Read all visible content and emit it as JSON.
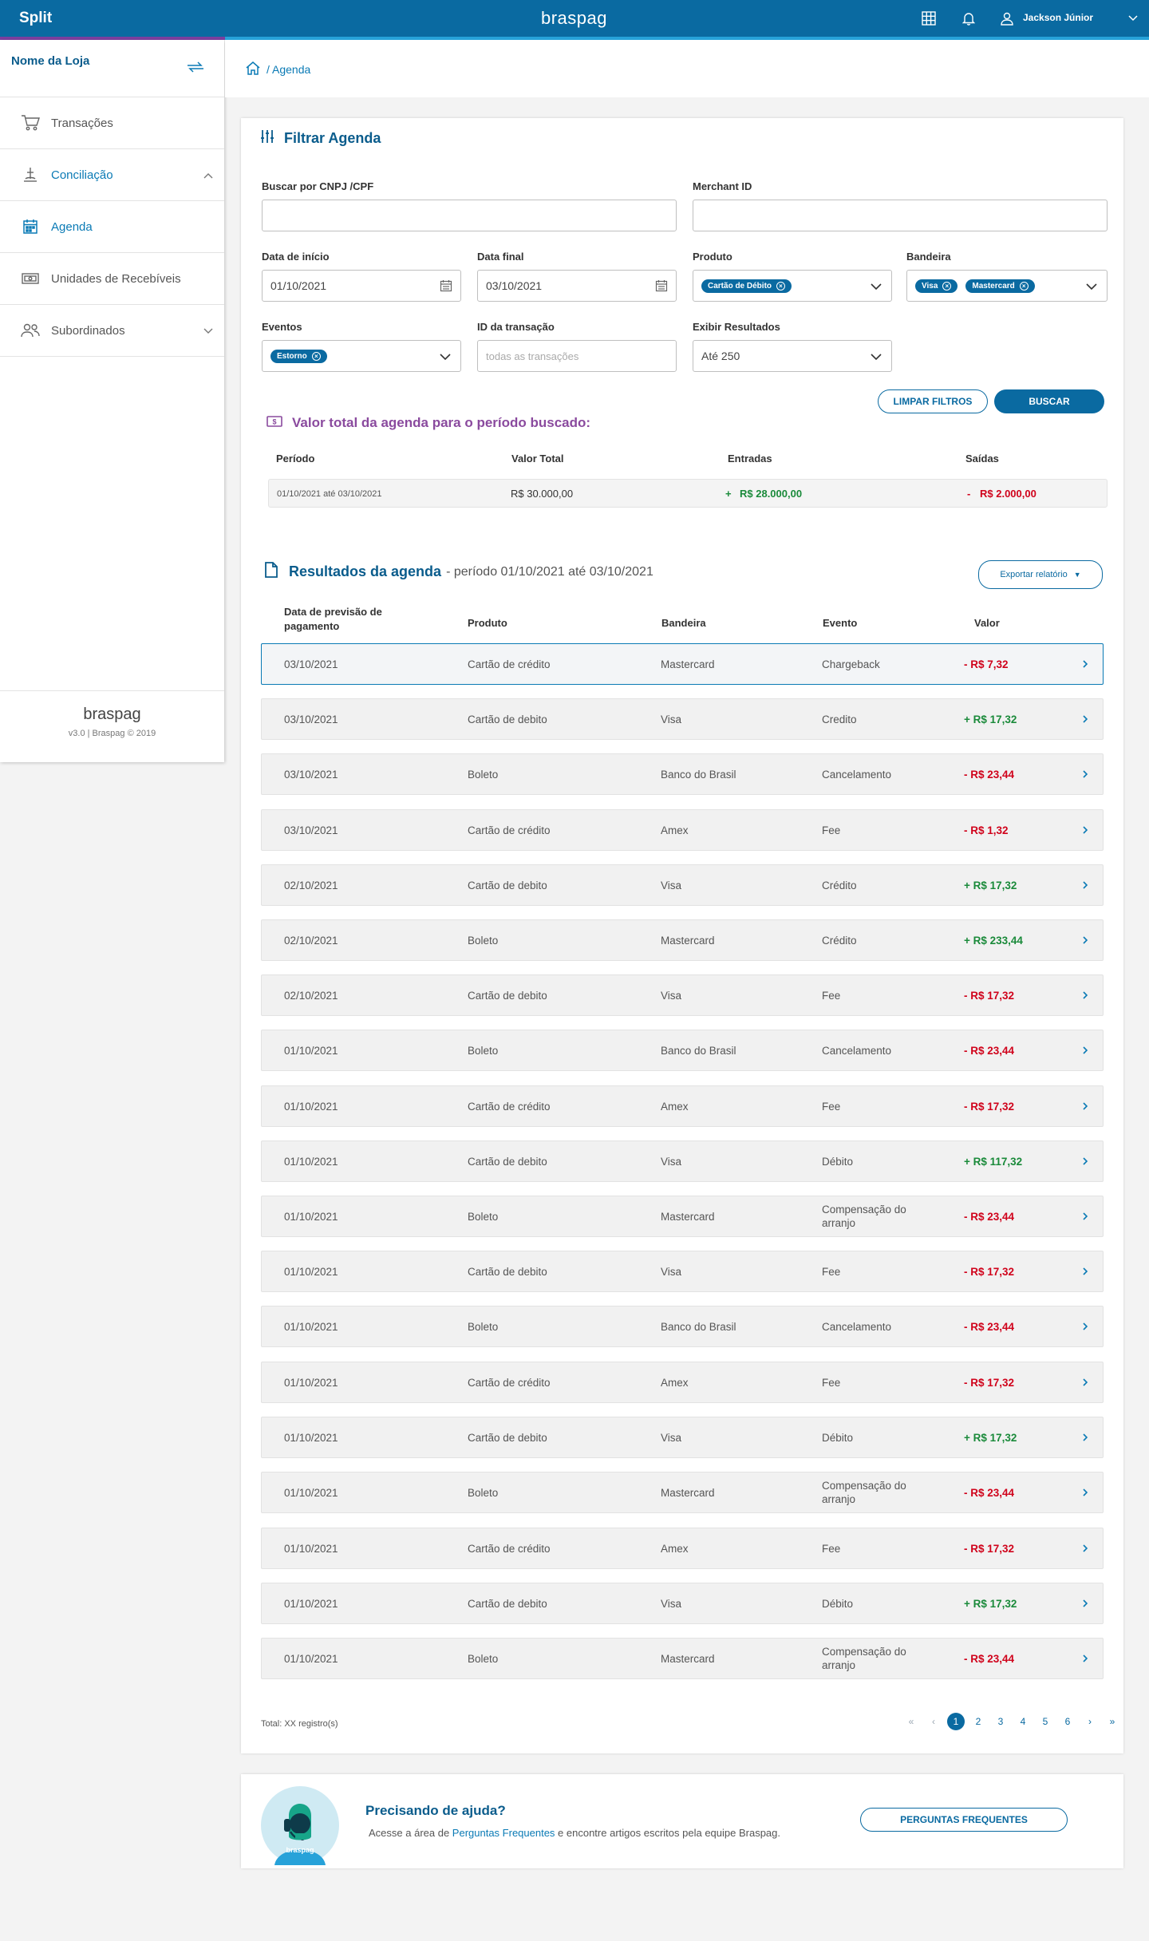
{
  "topbar": {
    "app_title": "Split",
    "brand": "braspag",
    "user_name": "Jackson Júnior"
  },
  "sidebar": {
    "store_name": "Nome da Loja",
    "items": [
      {
        "label": "Transações",
        "icon": "cart-icon"
      },
      {
        "label": "Conciliação",
        "icon": "scale-icon"
      },
      {
        "label": "Agenda",
        "icon": "calendar-icon"
      },
      {
        "label": "Unidades de Recebíveis",
        "icon": "money-icon"
      },
      {
        "label": "Subordinados",
        "icon": "users-icon"
      }
    ],
    "footer_logo": "braspag",
    "version": "v3.0 | Braspag © 2019"
  },
  "breadcrumb": {
    "current": "/ Agenda"
  },
  "filter": {
    "title": "Filtrar Agenda",
    "cnpj_label": "Buscar por CNPJ /CPF",
    "cnpj_value": "",
    "merchant_label": "Merchant ID",
    "merchant_value": "",
    "start_label": "Data de início",
    "start_value": "01/10/2021",
    "end_label": "Data final",
    "end_value": "03/10/2021",
    "produto_label": "Produto",
    "produto_chips": [
      "Cartão de Débito"
    ],
    "bandeira_label": "Bandeira",
    "bandeira_chips": [
      "Visa",
      "Mastercard"
    ],
    "eventos_label": "Eventos",
    "eventos_chips": [
      "Estorno"
    ],
    "transacao_label": "ID da transação",
    "transacao_placeholder": "todas as transações",
    "exibir_label": "Exibir Resultados",
    "exibir_value": "Até 250",
    "clear_button": "LIMPAR FILTROS",
    "search_button": "BUSCAR"
  },
  "totals": {
    "title": "Valor total da agenda para o período buscado:",
    "headers": {
      "periodo": "Período",
      "valor_total": "Valor Total",
      "entradas": "Entradas",
      "saidas": "Saídas"
    },
    "periodo": "01/10/2021 até 03/10/2021",
    "valor_total": "R$ 30.000,00",
    "entradas_sign": "+",
    "entradas": "R$ 28.000,00",
    "saidas_sign": "-",
    "saidas": "R$ 2.000,00"
  },
  "results": {
    "title": "Resultados da agenda",
    "period": "- período 01/10/2021 até 03/10/2021",
    "export_button": "Exportar relatório",
    "headers": {
      "data": "Data de previsão de pagamento",
      "produto": "Produto",
      "bandeira": "Bandeira",
      "evento": "Evento",
      "valor": "Valor"
    },
    "rows": [
      {
        "data": "03/10/2021",
        "produto": "Cartão de crédito",
        "bandeira": "Mastercard",
        "evento": "Chargeback",
        "valor": "-  R$ 7,32",
        "type": "neg"
      },
      {
        "data": "03/10/2021",
        "produto": "Cartão de debito",
        "bandeira": "Visa",
        "evento": "Credito",
        "valor": "+ R$ 17,32",
        "type": "pos"
      },
      {
        "data": "03/10/2021",
        "produto": "Boleto",
        "bandeira": "Banco do Brasil",
        "evento": "Cancelamento",
        "valor": "-  R$ 23,44",
        "type": "neg"
      },
      {
        "data": "03/10/2021",
        "produto": "Cartão de crédito",
        "bandeira": "Amex",
        "evento": "Fee",
        "valor": "-  R$ 1,32",
        "type": "neg"
      },
      {
        "data": "02/10/2021",
        "produto": "Cartão de debito",
        "bandeira": "Visa",
        "evento": "Crédito",
        "valor": "+  R$ 17,32",
        "type": "pos"
      },
      {
        "data": "02/10/2021",
        "produto": "Boleto",
        "bandeira": "Mastercard",
        "evento": "Crédito",
        "valor": "+  R$ 233,44",
        "type": "pos"
      },
      {
        "data": "02/10/2021",
        "produto": "Cartão de debito",
        "bandeira": "Visa",
        "evento": "Fee",
        "valor": "- R$ 17,32",
        "type": "neg"
      },
      {
        "data": "01/10/2021",
        "produto": "Boleto",
        "bandeira": "Banco do Brasil",
        "evento": "Cancelamento",
        "valor": "- R$ 23,44",
        "type": "neg"
      },
      {
        "data": "01/10/2021",
        "produto": "Cartão de crédito",
        "bandeira": "Amex",
        "evento": "Fee",
        "valor": "- R$ 17,32",
        "type": "neg"
      },
      {
        "data": "01/10/2021",
        "produto": "Cartão de debito",
        "bandeira": "Visa",
        "evento": "Débito",
        "valor": "+ R$ 117,32",
        "type": "pos"
      },
      {
        "data": "01/10/2021",
        "produto": "Boleto",
        "bandeira": "Mastercard",
        "evento": "Compensação do arranjo",
        "valor": "- R$ 23,44",
        "type": "neg"
      },
      {
        "data": "01/10/2021",
        "produto": "Cartão de debito",
        "bandeira": "Visa",
        "evento": "Fee",
        "valor": "- R$ 17,32",
        "type": "neg"
      },
      {
        "data": "01/10/2021",
        "produto": "Boleto",
        "bandeira": "Banco do Brasil",
        "evento": "Cancelamento",
        "valor": "- R$ 23,44",
        "type": "neg"
      },
      {
        "data": "01/10/2021",
        "produto": "Cartão de crédito",
        "bandeira": "Amex",
        "evento": "Fee",
        "valor": "- R$ 17,32",
        "type": "neg"
      },
      {
        "data": "01/10/2021",
        "produto": "Cartão de debito",
        "bandeira": "Visa",
        "evento": "Débito",
        "valor": "+ R$ 17,32",
        "type": "pos"
      },
      {
        "data": "01/10/2021",
        "produto": "Boleto",
        "bandeira": "Mastercard",
        "evento": "Compensação do arranjo",
        "valor": "- R$ 23,44",
        "type": "neg"
      },
      {
        "data": "01/10/2021",
        "produto": "Cartão de crédito",
        "bandeira": "Amex",
        "evento": "Fee",
        "valor": "- R$ 17,32",
        "type": "neg"
      },
      {
        "data": "01/10/2021",
        "produto": "Cartão de debito",
        "bandeira": "Visa",
        "evento": "Débito",
        "valor": "+ R$ 17,32",
        "type": "pos"
      },
      {
        "data": "01/10/2021",
        "produto": "Boleto",
        "bandeira": "Mastercard",
        "evento": "Compensação do arranjo",
        "valor": "- R$ 23,44",
        "type": "neg"
      }
    ],
    "total_records": "Total: XX registro(s)",
    "pages": [
      "1",
      "2",
      "3",
      "4",
      "5",
      "6"
    ],
    "current_page": "1"
  },
  "help": {
    "title": "Precisando de ajuda?",
    "desc_before": "Acesse a área de ",
    "desc_link": "Perguntas Frequentes",
    "desc_after": " e encontre artigos escritos pela equipe Braspag.",
    "button": "PERGUNTAS FREQUENTES",
    "avatar_label": "braspag"
  },
  "colors": {
    "primary": "#0a6aa1",
    "accent_purple": "#8a4a9e",
    "negative": "#d0021b",
    "positive": "#1a8a3a"
  }
}
